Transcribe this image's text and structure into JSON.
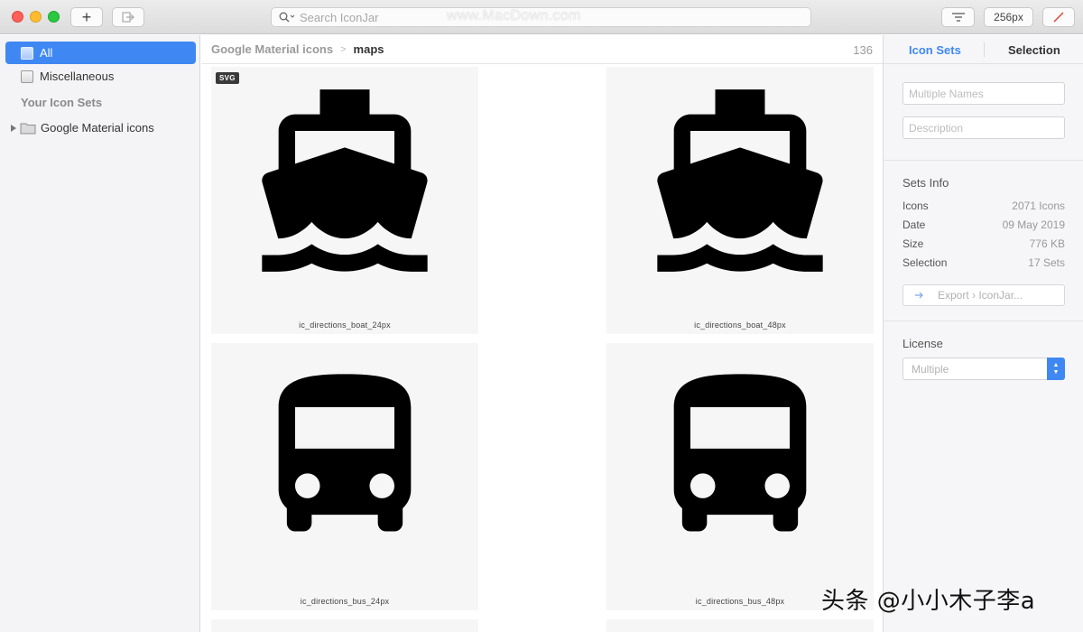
{
  "toolbar": {
    "add_label": "+",
    "search_placeholder": "Search IconJar",
    "size_label": "256px",
    "watermark": "www.MacDown.com"
  },
  "sidebar": {
    "items": [
      {
        "label": "All",
        "active": true
      },
      {
        "label": "Miscellaneous",
        "active": false
      }
    ],
    "section_heading": "Your Icon Sets",
    "sets": [
      {
        "label": "Google Material icons"
      }
    ]
  },
  "main": {
    "breadcrumb": {
      "parent": "Google Material icons",
      "current": "maps"
    },
    "count": "136",
    "badge": "SVG",
    "tiles": [
      {
        "label": "ic_directions_boat_24px",
        "icon": "boat-icon"
      },
      {
        "label": "ic_directions_boat_48px",
        "icon": "boat-icon"
      },
      {
        "label": "ic_directions_bus_24px",
        "icon": "bus-icon"
      },
      {
        "label": "ic_directions_bus_48px",
        "icon": "bus-icon"
      }
    ]
  },
  "inspector": {
    "tabs": [
      {
        "label": "Icon Sets",
        "active": true
      },
      {
        "label": "Selection",
        "active": false
      }
    ],
    "names_placeholder": "Multiple Names",
    "description_placeholder": "Description",
    "sets_info_title": "Sets Info",
    "info": [
      {
        "key": "Icons",
        "value": "2071 Icons"
      },
      {
        "key": "Date",
        "value": "09 May 2019"
      },
      {
        "key": "Size",
        "value": "776 KB"
      },
      {
        "key": "Selection",
        "value": "17 Sets"
      }
    ],
    "export_label": "Export › IconJar...",
    "license_title": "License",
    "license_value": "Multiple"
  },
  "footer_watermark": "头条 @小小木子李a",
  "colors": {
    "accent": "#3f88f4",
    "tab_active": "#3f88f4"
  }
}
